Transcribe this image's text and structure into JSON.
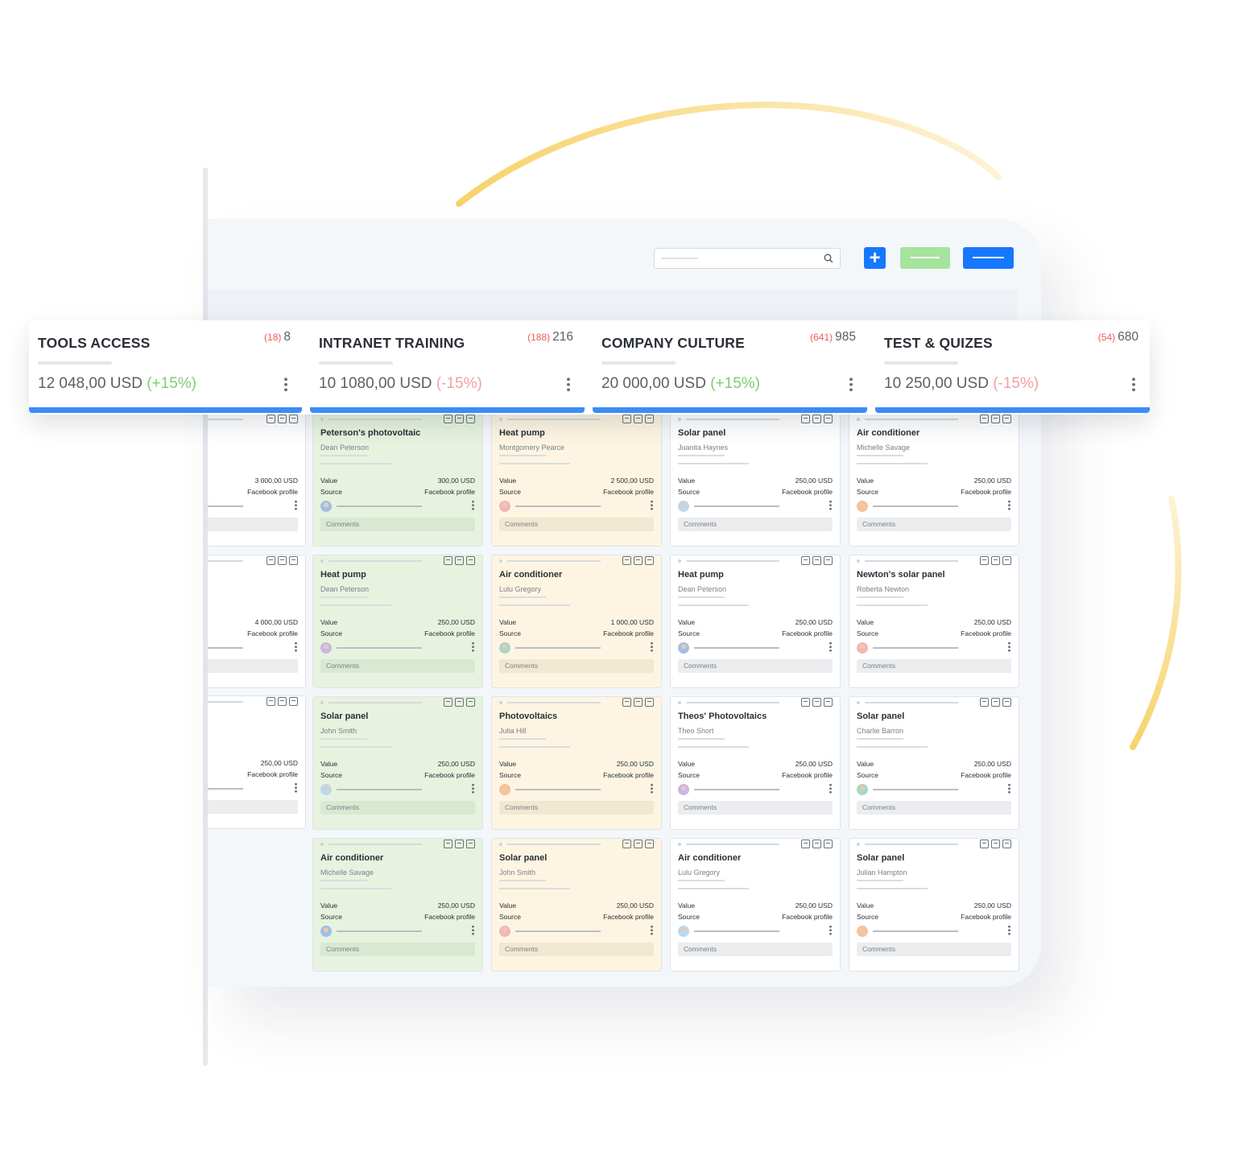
{
  "stats": [
    {
      "name": "TOOLS ACCESS",
      "count_red": "(18)",
      "count": "8",
      "amount": "12 048,00 USD",
      "delta": "(+15%)"
    },
    {
      "name": "INTRANET TRAINING",
      "count_red": "(188)",
      "count": "216",
      "amount": "10 1080,00 USD",
      "delta": "(-15%)"
    },
    {
      "name": "COMPANY CULTURE",
      "count_red": "(641)",
      "count": "985",
      "amount": "20 000,00 USD",
      "delta": "(+15%)"
    },
    {
      "name": "TEST & QUIZES",
      "count_red": "(54)",
      "count": "680",
      "amount": "10 250,00 USD",
      "delta": "(-15%)"
    }
  ],
  "toolbar": {
    "add_label": "+"
  },
  "labels": {
    "value": "Value",
    "source": "Source",
    "comments": "Comments"
  },
  "partial_cards": [
    {
      "value": "3 000,00 USD",
      "source": "Facebook profile"
    },
    {
      "value": "4 000,00 USD",
      "source": "Facebook profile"
    },
    {
      "value": "250,00 USD",
      "source": "Facebook profile"
    }
  ],
  "cards": [
    {
      "title": "Peterson's photovoltaic",
      "person": "Dean Peterson",
      "value": "300,00 USD",
      "source": "Facebook profile"
    },
    {
      "title": "Heat pump",
      "person": "Montgomery Pearce",
      "value": "2 500,00 USD",
      "source": "Facebook profile"
    },
    {
      "title": "Solar panel",
      "person": "Juanita Haynes",
      "value": "250,00 USD",
      "source": "Facebook profile"
    },
    {
      "title": "Air conditioner",
      "person": "Michelle Savage",
      "value": "250,00 USD",
      "source": "Facebook profile"
    },
    {
      "title": "Heat pump",
      "person": "Dean Peterson",
      "value": "250,00 USD",
      "source": "Facebook profile"
    },
    {
      "title": "Air conditioner",
      "person": "Lulu Gregory",
      "value": "1 000,00 USD",
      "source": "Facebook profile"
    },
    {
      "title": "Heat pump",
      "person": "Dean Peterson",
      "value": "250,00 USD",
      "source": "Facebook profile"
    },
    {
      "title": "Newton's solar panel",
      "person": "Roberta Newton",
      "value": "250,00 USD",
      "source": "Facebook profile"
    },
    {
      "title": "Solar panel",
      "person": "John Smith",
      "value": "250,00 USD",
      "source": "Facebook profile"
    },
    {
      "title": "Photovoltaics",
      "person": "Julia Hill",
      "value": "250,00 USD",
      "source": "Facebook profile"
    },
    {
      "title": "Theos' Photovoltaics",
      "person": "Theo Short",
      "value": "250,00 USD",
      "source": "Facebook profile"
    },
    {
      "title": "Solar panel",
      "person": "Charlie Barron",
      "value": "250,00 USD",
      "source": "Facebook profile"
    },
    {
      "title": "Air conditioner",
      "person": "Michelle Savage",
      "value": "250,00 USD",
      "source": "Facebook profile"
    },
    {
      "title": "Solar panel",
      "person": "John Smith",
      "value": "250,00 USD",
      "source": "Facebook profile"
    },
    {
      "title": "Air conditioner",
      "person": "Lulu Gregory",
      "value": "250,00 USD",
      "source": "Facebook profile"
    },
    {
      "title": "Solar panel",
      "person": "Julian Hampton",
      "value": "250,00 USD",
      "source": "Facebook profile"
    }
  ],
  "colors": {
    "accent": "#1677ff",
    "green_button": "#a6e39d",
    "stat_underbar": "#3b8cf5",
    "green_column": "#e7f3df",
    "yellow_column": "#fdf5e2",
    "positive": "#7ccd70",
    "negative": "#f0a0a4",
    "count_red": "#e85d5d",
    "arc": "#f7d36b"
  }
}
